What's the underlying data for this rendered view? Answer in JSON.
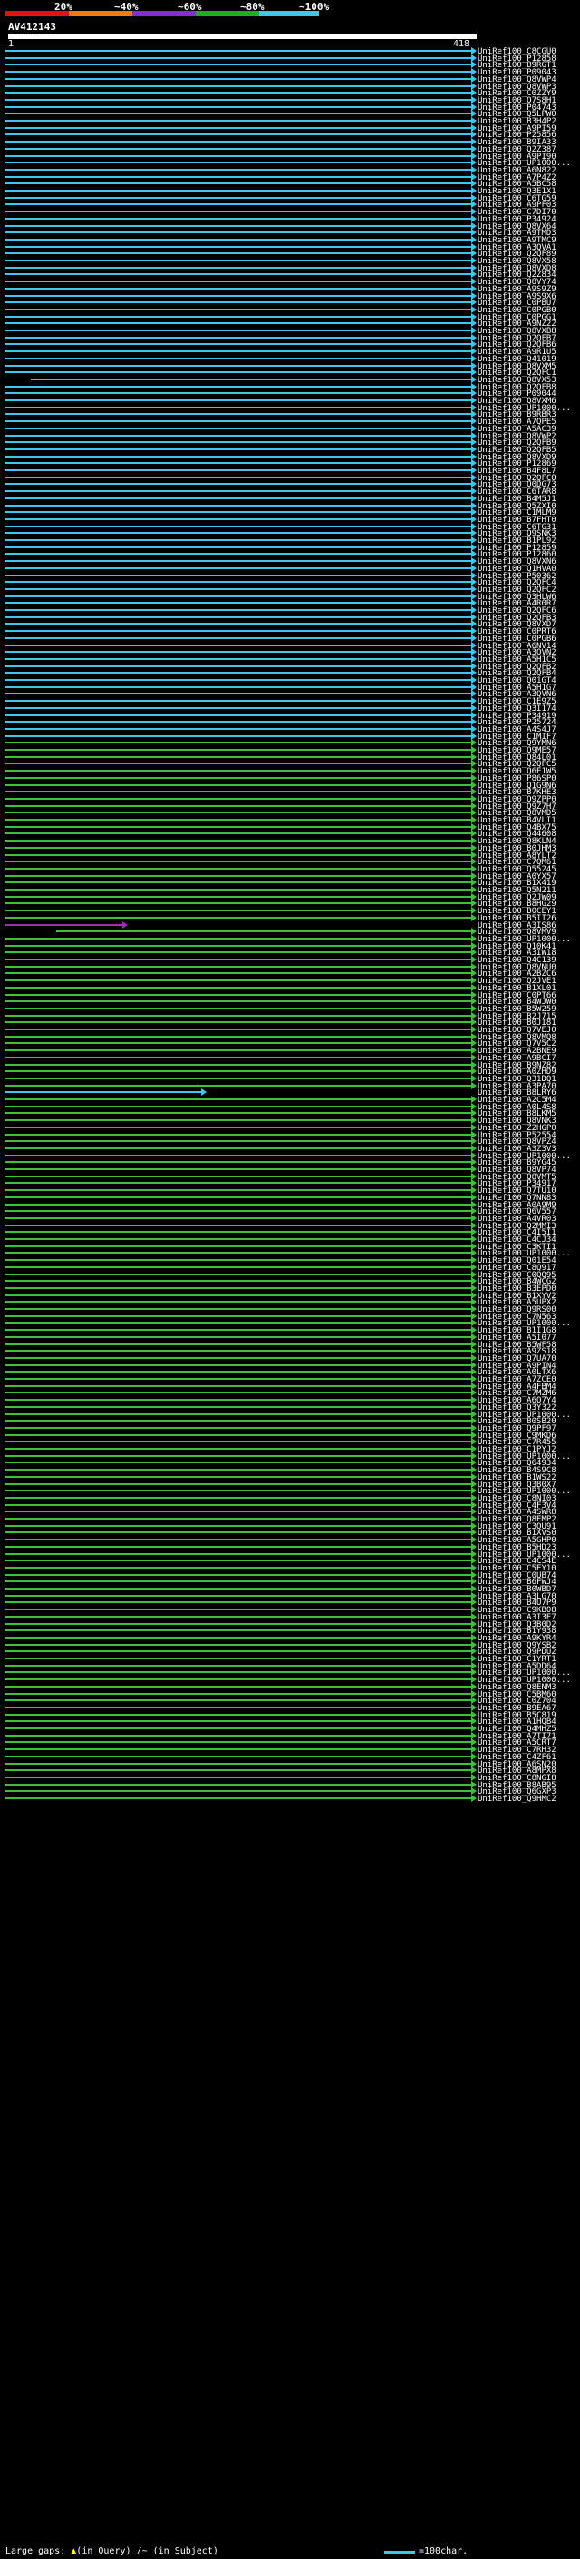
{
  "scale": {
    "labels": [
      "20%",
      "~40%",
      "~60%",
      "~80%",
      "~100%"
    ],
    "colors": [
      "#e01212",
      "#f07c10",
      "#8a2bd1",
      "#1fae1f",
      "#3fc6e8"
    ]
  },
  "query": {
    "name": "AV412143",
    "start": "1",
    "end": "418"
  },
  "colors": {
    "cyan": "#3fc6e8",
    "green": "#3ebf3e",
    "purple": "#9b2fb0",
    "black": "#000000"
  },
  "hits": [
    "UniRef100_C8CGU0",
    "UniRef100_P12858",
    "UniRef100_B9RGT1",
    "UniRef100_P09043",
    "UniRef100_Q8VWP4",
    "UniRef100_Q8VWP3",
    "UniRef100_C0ZZY9",
    "UniRef100_Q7S8H1",
    "UniRef100_P04743",
    "UniRef100_Q5LPW0",
    "UniRef100_B3H4P2",
    "UniRef100_A9PI59",
    "UniRef100_P25856",
    "UniRef100_B9IA33",
    "UniRef100_Q2Z387",
    "UniRef100_A9PI90",
    "UniRef100_UP1000...",
    "UniRef100_A6N822",
    "UniRef100_A7P4Z2",
    "UniRef100_A5BC58",
    "UniRef100_Q3E1X1",
    "UniRef100_C6TG59",
    "UniRef100_A9PF03",
    "UniRef100_C7DI70",
    "UniRef100_P34924",
    "UniRef100_Q8VX64",
    "UniRef100_A9TMD3",
    "UniRef100_A9TMC9",
    "UniRef100_A3QVA1",
    "UniRef100_Q2QF89",
    "UniRef100_Q8VX58",
    "UniRef100_Q8VXD8",
    "UniRef100_Q2Z834",
    "UniRef100_Q8VY74",
    "UniRef100_A9S9Z9",
    "UniRef100_A9S9X6",
    "UniRef100_C0PBU7",
    "UniRef100_C0PGB0",
    "UniRef100_C0PGG1",
    "UniRef100_A9NZ22",
    "UniRef100_Q8VXB8",
    "UniRef100_Q2QFB7",
    "UniRef100_Q2QFB6",
    "UniRef100_A9R1U5",
    "UniRef100_Q41019",
    "UniRef100_Q8VXM5",
    "UniRef100_Q2QFC1",
    "UniRef100_Q8VX53",
    "UniRef100_Q2QFB8",
    "UniRef100_P09044",
    "UniRef100_Q8VXM6",
    "UniRef100_UP1000...",
    "UniRef100_B9RBR3",
    "UniRef100_A7QPE5",
    "UniRef100_A5AC39",
    "UniRef100_Q8VWP2",
    "UniRef100_Q2QFB9",
    "UniRef100_Q2QFB5",
    "UniRef100_Q8VXD9",
    "UniRef100_P12869",
    "UniRef100_B4F8L7",
    "UniRef100_Q2QFC0",
    "UniRef100_Q0DG73",
    "UniRef100_C6TAR8",
    "UniRef100_B4M5J1",
    "UniRef100_Q5ZXI0",
    "UniRef100_C1MLM9",
    "UniRef100_B7FHT0",
    "UniRef100_C6TG31",
    "UniRef100_Q9SNK3",
    "UniRef100_B1PL92",
    "UniRef100_P12859",
    "UniRef100_P12860",
    "UniRef100_Q8VXN6",
    "UniRef100_Q1HVA0",
    "UniRef100_P50362",
    "UniRef100_Q2QFC4",
    "UniRef100_Q2QFC2",
    "UniRef100_Q3HLW6",
    "UniRef100_A4R0R7",
    "UniRef100_Q2QFC6",
    "UniRef100_Q2QFB3",
    "UniRef100_Q8VXD7",
    "UniRef100_C0PRT6",
    "UniRef100_C0PGB6",
    "UniRef100_A6NV14",
    "UniRef100_A3QVN2",
    "UniRef100_A5H1C5",
    "UniRef100_Q2QFB2",
    "UniRef100_Q2QFB4",
    "UniRef100_Q01GT4",
    "UniRef100_A5H1G7",
    "UniRef100_A3QVN6",
    "UniRef100_C1E9Z5",
    "UniRef100_Q3I174",
    "UniRef100_P34919",
    "UniRef100_P25724",
    "UniRef100_A4S4J7",
    "UniRef100_C1MIF7",
    "UniRef100_Q9YMN6",
    "UniRef100_Q9ME57",
    "UniRef100_Q84L01",
    "UniRef100_Q2QFC5",
    "UniRef100_Q6E1W5",
    "UniRef100_P86SP0",
    "UniRef100_Q1G9N6",
    "UniRef100_B7KHE3",
    "UniRef100_Q9ZPP0",
    "UniRef100_Q9Z7H7",
    "UniRef100_Q8VMD5",
    "UniRef100_B4VLI1",
    "UniRef100_Q4BX75",
    "UniRef100_Q44608",
    "UniRef100_Q8KLN4",
    "UniRef100_B0JHM3",
    "UniRef100_A8YLT2",
    "UniRef100_C7QM61",
    "UniRef100_Q55245",
    "UniRef100_A0YX57",
    "UniRef100_B1X419",
    "UniRef100_Q5N211",
    "UniRef100_Q2JW09",
    "UniRef100_B8HG29",
    "UniRef100_B0CEY1",
    "UniRef100_B5II26",
    "UniRef100_A3IS86",
    "UniRef100_Q8VMV9",
    "UniRef100_UP1000...",
    "UniRef100_Q10K41",
    "UniRef100_A3IW18",
    "UniRef100_Q4C139",
    "UniRef100_Q8VNU0",
    "UniRef100_A2BZC6",
    "UniRef100_Q2JVE1",
    "UniRef100_B1XL01",
    "UniRef100_C0PT66",
    "UniRef100_B4WJW0",
    "UniRef100_B5W259",
    "UniRef100_B2J715",
    "UniRef100_B0JI81",
    "UniRef100_Q7VEJ0",
    "UniRef100_Q8VMQ8",
    "UniRef100_Q7V5C2",
    "UniRef100_A2BNE9",
    "UniRef100_A9BCI7",
    "UniRef100_B9NZ82",
    "UniRef100_A0ZHD9",
    "UniRef100_Q31DQ1",
    "UniRef100_A3PA70",
    "UniRef100_B8LRY6",
    "UniRef100_A2C5M4",
    "UniRef100_A0L4S8",
    "UniRef100_B8LKM5",
    "UniRef100_Q8VNK3",
    "UniRef100_Z2HGP0",
    "UniRef100_P52554",
    "UniRef100_Q8VPZ4",
    "UniRef100_A3Z3V3",
    "UniRef100_UP1000...",
    "UniRef100_B9YG45",
    "UniRef100_Q8VP74",
    "UniRef100_Q8VMT5",
    "UniRef100_P34917",
    "UniRef100_Q7TU10",
    "UniRef100_Q7NN83",
    "UniRef100_A0A9M9",
    "UniRef100_Q6V557",
    "UniRef100_A4VR03",
    "UniRef100_Q2MMI3",
    "UniRef100_C4I5I1",
    "UniRef100_C4CJ34",
    "UniRef100_C3KTI1",
    "UniRef100_UP1000...",
    "UniRef100_Q01E54",
    "UniRef100_C8Q917",
    "UniRef100_C0QQ95",
    "UniRef100_B4WCG2",
    "UniRef100_B3EPD0",
    "UniRef100_B1XYV2",
    "UniRef100_A5UPX2",
    "UniRef100_Q9RS00",
    "UniRef100_C7N563",
    "UniRef100_UP1000...",
    "UniRef100_B1I1G8",
    "UniRef100_A5I077",
    "UniRef100_B5WF58",
    "UniRef100_A9ZS18",
    "UniRef100_Q7UA70",
    "UniRef100_A9PIN4",
    "UniRef100_A0LTX6",
    "UniRef100_A7ZCE0",
    "UniRef100_A4FBM4",
    "UniRef100_C7MZM6",
    "UniRef100_A6Q7Y4",
    "UniRef100_Q3Y322",
    "UniRef100_UP1000...",
    "UniRef100_B0SB20",
    "UniRef100_Q9PF97",
    "UniRef100_C9MKD6",
    "UniRef100_C7R455",
    "UniRef100_C1PYJ2",
    "UniRef100_UP1000...",
    "UniRef100_Q64934",
    "UniRef100_B4S9C8",
    "UniRef100_B1WS22",
    "UniRef100_Q3B0X7",
    "UniRef100_UP1000...",
    "UniRef100_C8NI03",
    "UniRef100_C4F3V4",
    "UniRef100_A4SWR8",
    "UniRef100_Q8EMP2",
    "UniRef100_C3QU91",
    "UniRef100_B1XVS0",
    "UniRef100_A5GHP0",
    "UniRef100_B5HD23",
    "UniRef100_UP1000...",
    "UniRef100_C4CS4E",
    "UniRef100_C5EY10",
    "UniRef100_C0UB74",
    "UniRef100_B6FWJ4",
    "UniRef100_B0WBD7",
    "UniRef100_A3LG70",
    "UniRef100_B4U7P9",
    "UniRef100_C9KB08",
    "UniRef100_A3I3E7",
    "UniRef100_Q3B0D2",
    "UniRef100_B1Y938",
    "UniRef100_A9KYR4",
    "UniRef100_Q9YSB2",
    "UniRef100_Q9PDU2",
    "UniRef100_C1YRT1",
    "UniRef100_A5DD64",
    "UniRef100_UP1000...",
    "UniRef100_UP1000...",
    "UniRef100_Q8ENM3",
    "UniRef100_C5BM60",
    "UniRef100_C0Z704",
    "UniRef100_B9EA67",
    "UniRef100_B5C819",
    "UniRef100_A1HQB4",
    "UniRef100_Q4MHZ5",
    "UniRef100_A7TI71",
    "UniRef100_A5CRT7",
    "UniRef100_C7RH32",
    "UniRef100_C4ZF61",
    "UniRef100_A6SN20",
    "UniRef100_A8MPX8",
    "UniRef100_C8NGI8",
    "UniRef100_B8AB95",
    "UniRef100_Q6GXP3",
    "UniRef100_Q9HMC2"
  ],
  "footer": {
    "gaps_label": "Large gaps:",
    "gaps_query": "(in Query)",
    "gaps_subject": "/~ (in Subject)",
    "scale_label": "=100char."
  }
}
